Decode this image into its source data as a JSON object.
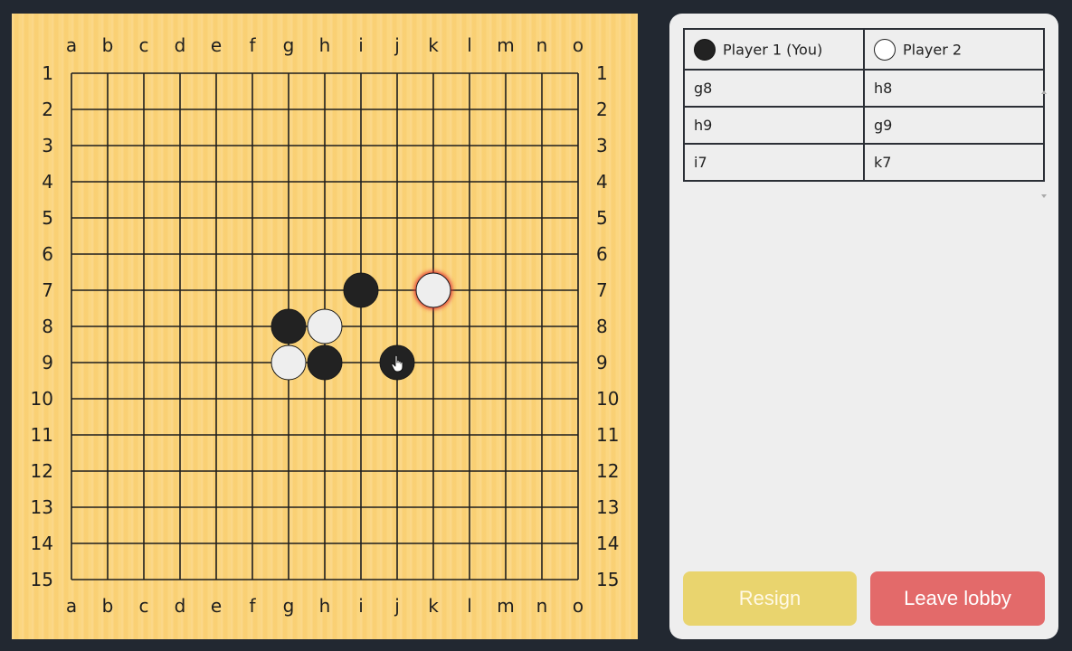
{
  "board": {
    "columns": [
      "a",
      "b",
      "c",
      "d",
      "e",
      "f",
      "g",
      "h",
      "i",
      "j",
      "k",
      "l",
      "m",
      "n",
      "o"
    ],
    "rows": [
      "1",
      "2",
      "3",
      "4",
      "5",
      "6",
      "7",
      "8",
      "9",
      "10",
      "11",
      "12",
      "13",
      "14",
      "15"
    ],
    "stones": [
      {
        "point": "i7",
        "color": "black"
      },
      {
        "point": "k7",
        "color": "white",
        "last_move": true
      },
      {
        "point": "g8",
        "color": "black"
      },
      {
        "point": "h8",
        "color": "white"
      },
      {
        "point": "g9",
        "color": "white"
      },
      {
        "point": "h9",
        "color": "black"
      }
    ],
    "hover": {
      "point": "j9",
      "color": "black",
      "cursor": "hand-pointer-icon"
    },
    "colors": {
      "wood": "#fbd37a",
      "grid": "#1e1e1e",
      "black_stone": "#222222",
      "white_stone": "#eeeeee",
      "last_move_glow": "#e03030"
    }
  },
  "panel": {
    "player1": {
      "label": "Player 1 (You)",
      "stone": "black"
    },
    "player2": {
      "label": "Player 2",
      "stone": "white"
    },
    "moves": [
      {
        "p1": "g8",
        "p2": "h8"
      },
      {
        "p1": "h9",
        "p2": "g9"
      },
      {
        "p1": "i7",
        "p2": "k7"
      }
    ],
    "resign_label": "Resign",
    "leave_label": "Leave lobby"
  }
}
